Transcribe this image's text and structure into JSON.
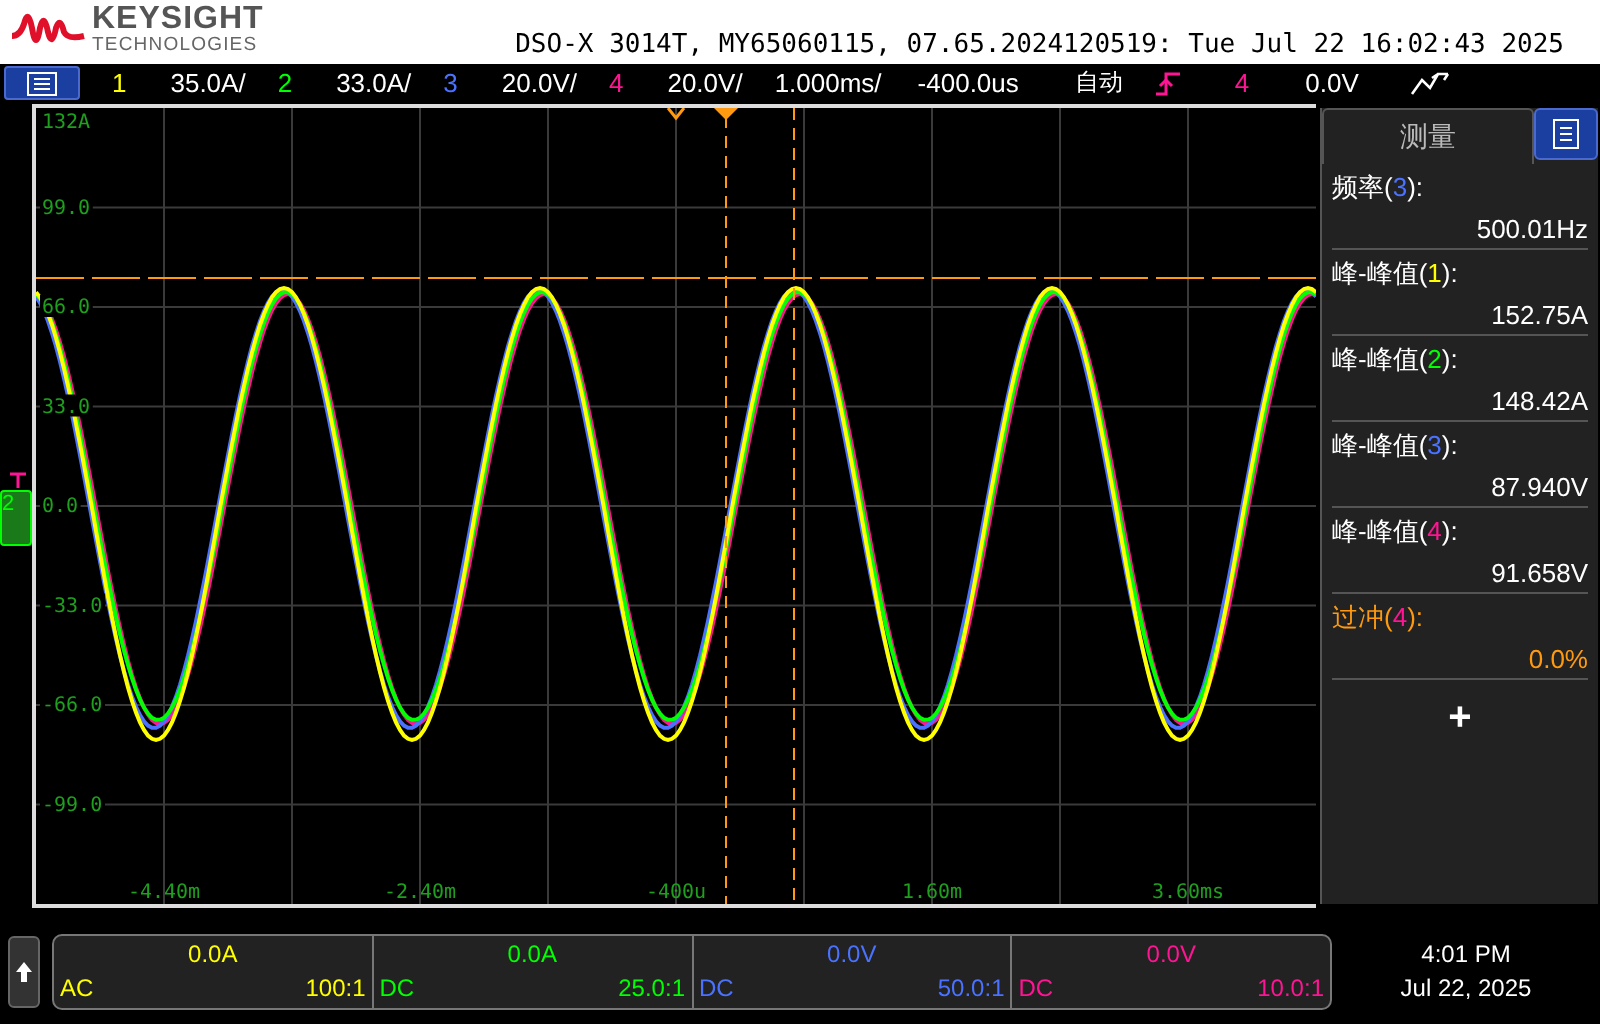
{
  "header": {
    "brand": "KEYSIGHT",
    "brand_subtitle": "TECHNOLOGIES",
    "title": "DSO-X 3014T, MY65060115, 07.65.2024120519: Tue Jul 22 16:02:43 2025"
  },
  "channels": [
    {
      "number": "1",
      "scale": "35.0A/",
      "color": "#ffff00",
      "offset": "0.0A",
      "coupling": "AC",
      "probe": "100:1"
    },
    {
      "number": "2",
      "scale": "33.0A/",
      "color": "#00ff00",
      "offset": "0.0A",
      "coupling": "DC",
      "probe": "25.0:1"
    },
    {
      "number": "3",
      "scale": "20.0V/",
      "color": "#4a72ff",
      "offset": "0.0V",
      "coupling": "DC",
      "probe": "50.0:1"
    },
    {
      "number": "4",
      "scale": "20.0V/",
      "color": "#ff1493",
      "offset": "0.0V",
      "coupling": "DC",
      "probe": "10.0:1"
    }
  ],
  "timebase": {
    "scale": "1.000ms/",
    "delay": "-400.0us"
  },
  "trigger": {
    "mode": "自动",
    "source": "4",
    "color": "#ff1493",
    "level": "0.0V"
  },
  "graticule": {
    "y_labels": [
      "132A",
      "99.0",
      "66.0",
      "33.0",
      "0.0",
      "-33.0",
      "-66.0",
      "-99.0"
    ],
    "x_labels": [
      "-4.40m",
      "-2.40m",
      "-400u",
      "1.60m",
      "3.60ms"
    ],
    "ground_marker": "2"
  },
  "measurements": {
    "title": "测量",
    "items": [
      {
        "prefix": "频率(",
        "channel": "3",
        "suffix": "):",
        "color": "#4a72ff",
        "value": "500.01Hz",
        "highlighted": false
      },
      {
        "prefix": "峰-峰值(",
        "channel": "1",
        "suffix": "):",
        "color": "#ffff00",
        "value": "152.75A",
        "highlighted": false
      },
      {
        "prefix": "峰-峰值(",
        "channel": "2",
        "suffix": "):",
        "color": "#00ff00",
        "value": "148.42A",
        "highlighted": false
      },
      {
        "prefix": "峰-峰值(",
        "channel": "3",
        "suffix": "):",
        "color": "#4a72ff",
        "value": "87.940V",
        "highlighted": false
      },
      {
        "prefix": "峰-峰值(",
        "channel": "4",
        "suffix": "):",
        "color": "#ff1493",
        "value": "91.658V",
        "highlighted": false
      },
      {
        "prefix": "过冲(",
        "channel": "4",
        "suffix": "):",
        "color": "#ff1493",
        "value": "0.0%",
        "highlighted": true
      }
    ],
    "add_button": "+"
  },
  "clock": {
    "time": "4:01 PM",
    "date": "Jul 22, 2025"
  }
}
